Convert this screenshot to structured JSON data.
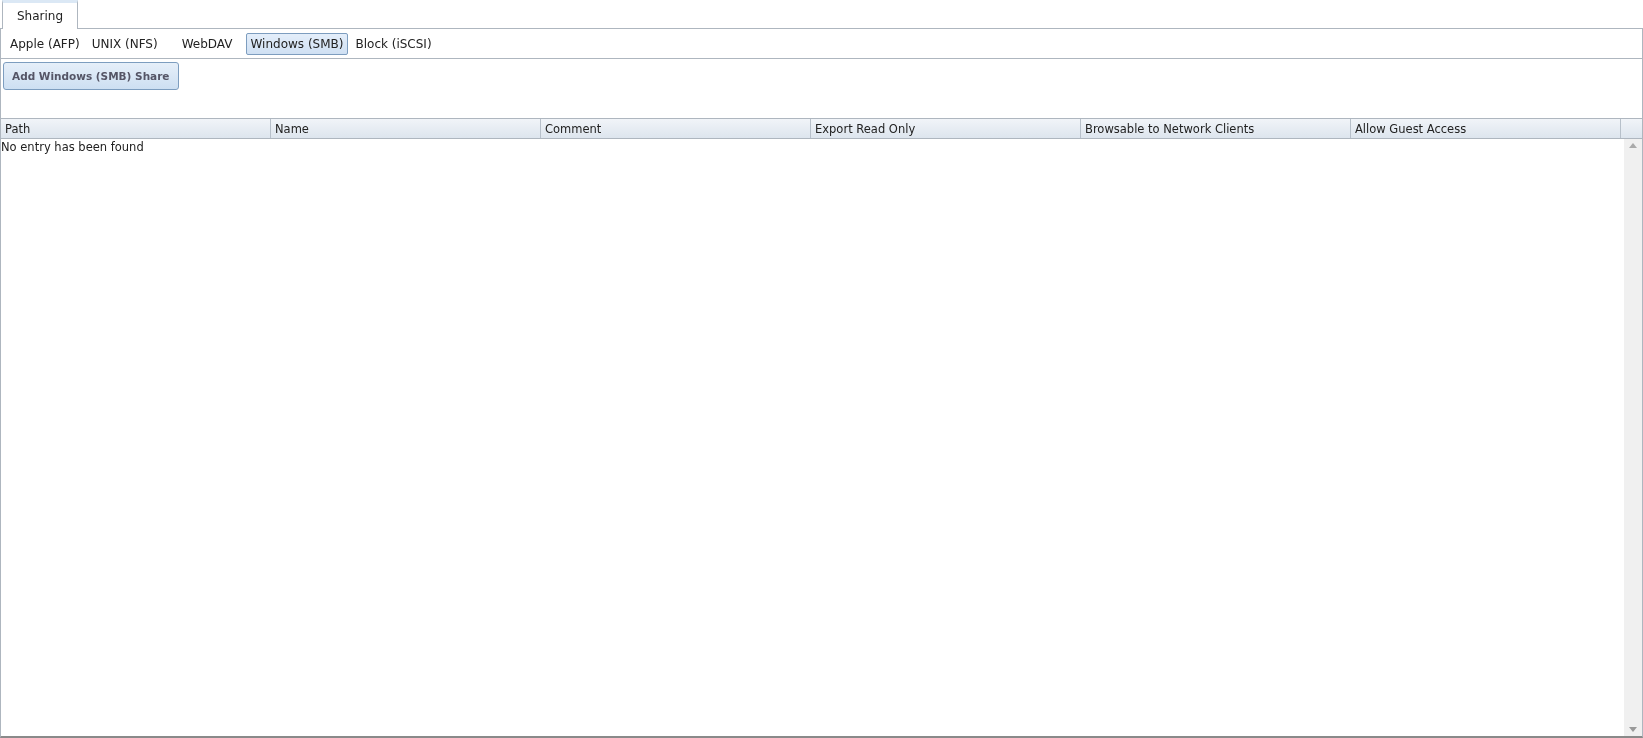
{
  "tabs": [
    {
      "label": "Sharing",
      "selected": true
    }
  ],
  "subtabs": [
    {
      "label": "Apple (AFP)",
      "selected": false
    },
    {
      "label": "UNIX (NFS)",
      "selected": false
    },
    {
      "label": "WebDAV",
      "selected": false
    },
    {
      "label": "Windows (SMB)",
      "selected": true
    },
    {
      "label": "Block (iSCSI)",
      "selected": false
    }
  ],
  "add_button": "Add Windows (SMB) Share",
  "table": {
    "columns": [
      "Path",
      "Name",
      "Comment",
      "Export Read Only",
      "Browsable to Network Clients",
      "Allow Guest Access"
    ],
    "empty_message": "No entry has been found"
  }
}
